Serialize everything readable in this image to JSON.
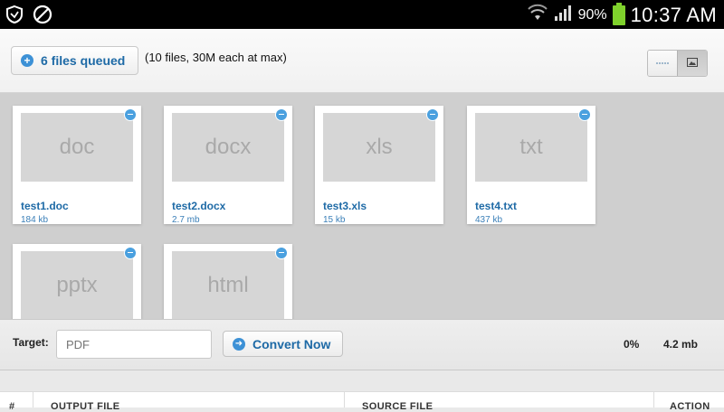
{
  "status_bar": {
    "battery": "90%",
    "time": "10:37 AM",
    "icons": [
      "shield-icon",
      "blocked-icon",
      "wifi-icon",
      "signal-icon",
      "battery-icon"
    ]
  },
  "toolbar": {
    "queue_label": "6 files queued",
    "limit_note": "(10 files, 30M each at max)",
    "view_modes": [
      "list-view-icon",
      "grid-view-icon"
    ]
  },
  "files": [
    {
      "ext": "doc",
      "name": "test1.doc",
      "size": "184 kb"
    },
    {
      "ext": "docx",
      "name": "test2.docx",
      "size": "2.7 mb"
    },
    {
      "ext": "xls",
      "name": "test3.xls",
      "size": "15 kb"
    },
    {
      "ext": "txt",
      "name": "test4.txt",
      "size": "437 kb"
    },
    {
      "ext": "pptx",
      "name": "",
      "size": ""
    },
    {
      "ext": "html",
      "name": "",
      "size": ""
    }
  ],
  "convert": {
    "target_label": "Target:",
    "target_placeholder": "PDF",
    "button_label": "Convert Now",
    "progress": "0%",
    "total_size": "4.2 mb"
  },
  "results": {
    "columns": [
      "#",
      "OUTPUT FILE",
      "SOURCE FILE",
      "ACTION"
    ]
  },
  "colors": {
    "accent": "#1e6aa6",
    "battery": "#7fd12c",
    "grid_bg": "#cfcfcf"
  }
}
